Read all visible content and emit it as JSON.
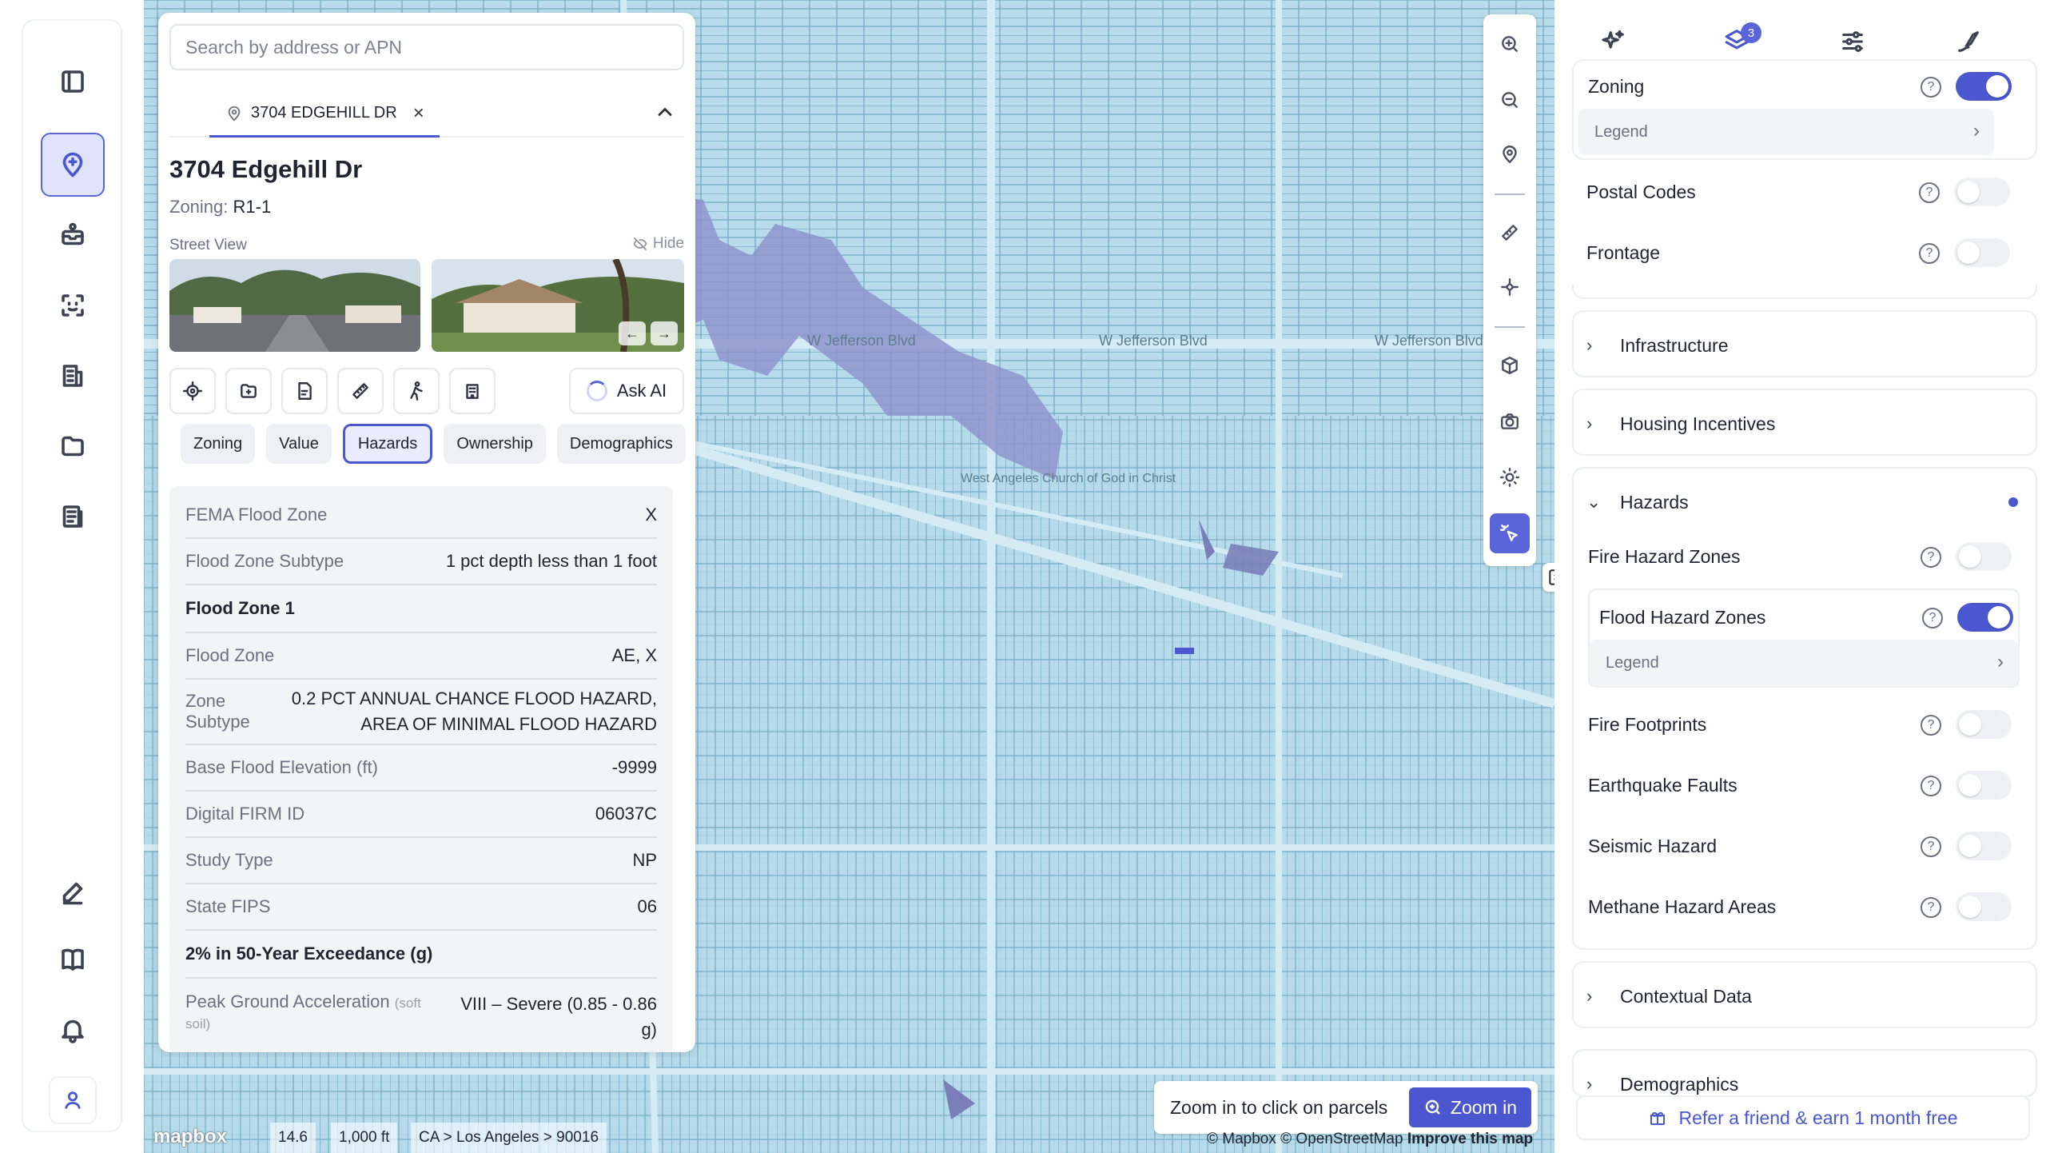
{
  "search": {
    "placeholder": "Search by address or APN"
  },
  "tab": {
    "address": "3704 EDGEHILL DR"
  },
  "property": {
    "title": "3704 Edgehill Dr",
    "zoning_label": "Zoning:",
    "zoning_value": "R1-1",
    "street_view_label": "Street View",
    "hide_label": "Hide",
    "ask_ai": "Ask AI"
  },
  "chips": [
    "Zoning",
    "Value",
    "Hazards",
    "Ownership",
    "Demographics"
  ],
  "active_chip": "Hazards",
  "hazards_rows": [
    {
      "k": "FEMA Flood Zone",
      "v": "X"
    },
    {
      "k": "Flood Zone Subtype",
      "v": "1 pct depth less than 1 foot"
    },
    {
      "section": "Flood Zone 1"
    },
    {
      "k": "Flood Zone",
      "v": "AE, X"
    },
    {
      "k": "Zone Subtype",
      "v": "0.2 PCT ANNUAL CHANCE FLOOD HAZARD, AREA OF MINIMAL FLOOD HAZARD"
    },
    {
      "k": "Base Flood Elevation (ft)",
      "v": "-9999"
    },
    {
      "k": "Digital FIRM ID",
      "v": "06037C"
    },
    {
      "k": "Study Type",
      "v": "NP"
    },
    {
      "k": "State FIPS",
      "v": "06"
    },
    {
      "section": "2% in 50-Year Exceedance (g)"
    },
    {
      "k": "Peak Ground Acceleration",
      "k_note": "(soft soil)",
      "v": "VIII – Severe (0.85 - 0.86 g)"
    }
  ],
  "map": {
    "street_labels": [
      "W Jefferson Blvd",
      "W Jefferson Blvd",
      "W Jefferson Blvd",
      "West Angeles Church of God in Christ"
    ],
    "zoom_hint": "Zoom in to click on parcels",
    "zoom_button": "Zoom in",
    "zoom_level": "14.6",
    "scale": "1,000 ft",
    "breadcrumb": "CA > Los Angeles > 90016",
    "attribution": "© Mapbox © OpenStreetMap",
    "improve": "Improve this map",
    "logo": "mapbox"
  },
  "layers": {
    "tab_badge": "3",
    "zoning": {
      "label": "Zoning",
      "on": true,
      "legend": "Legend"
    },
    "postal_codes": {
      "label": "Postal Codes",
      "on": false
    },
    "frontage": {
      "label": "Frontage",
      "on": false
    },
    "groups": {
      "infrastructure": "Infrastructure",
      "housing_incentives": "Housing Incentives",
      "hazards": "Hazards",
      "contextual": "Contextual Data",
      "demographics": "Demographics"
    },
    "hazards_items": [
      {
        "label": "Fire Hazard Zones",
        "on": false
      },
      {
        "label": "Flood Hazard Zones",
        "on": true,
        "legend": "Legend"
      },
      {
        "label": "Fire Footprints",
        "on": false
      },
      {
        "label": "Earthquake Faults",
        "on": false
      },
      {
        "label": "Seismic Hazard",
        "on": false
      },
      {
        "label": "Methane Hazard Areas",
        "on": false
      }
    ],
    "refer": "Refer a friend & earn 1 month free"
  },
  "colors": {
    "accent": "#4b57cf",
    "map_water": "#b7dbea",
    "flood": "#8f94cc"
  }
}
